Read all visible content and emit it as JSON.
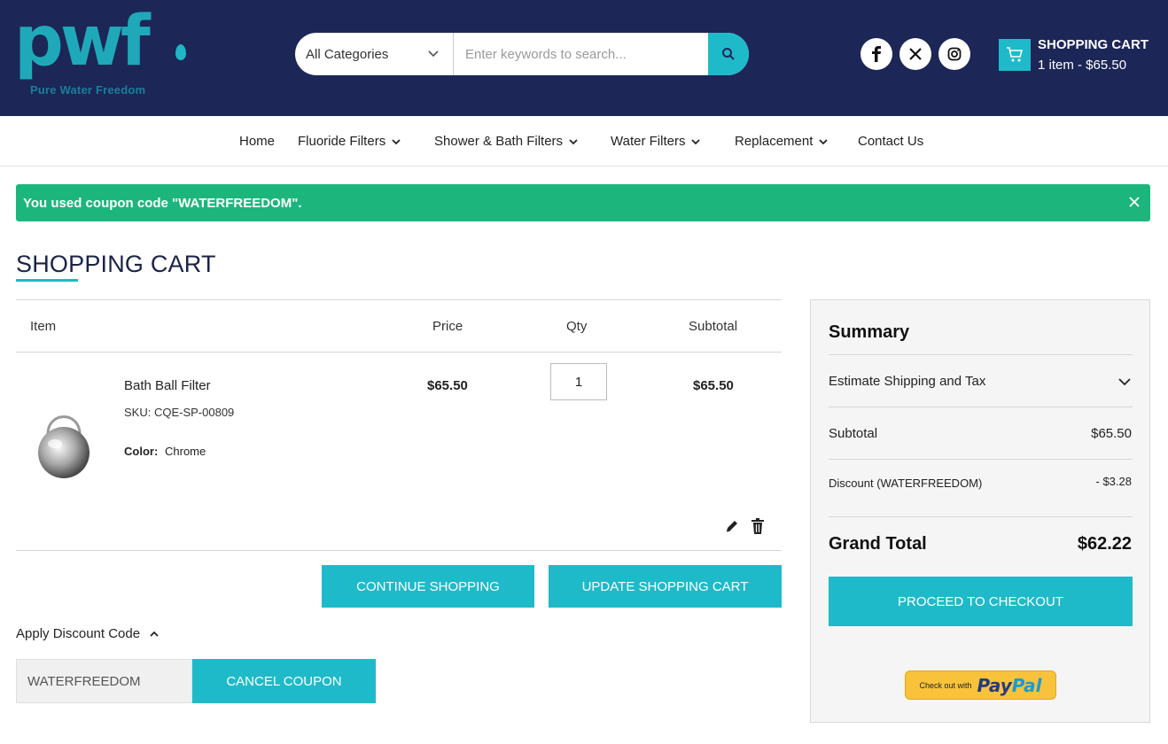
{
  "brand": {
    "logo_text": "pwf",
    "tagline": "Pure Water Freedom",
    "color": "#1fa9b8"
  },
  "header": {
    "bg_color": "#1c2657",
    "search": {
      "category": "All Categories",
      "placeholder": "Enter keywords to search...",
      "button_icon": "search-icon"
    },
    "social": [
      "facebook-icon",
      "x-icon",
      "instagram-icon"
    ],
    "cart": {
      "title": "SHOPPING CART",
      "summary": "1 item - $65.50",
      "icon": "cart-icon"
    }
  },
  "nav": {
    "items": [
      {
        "label": "Home",
        "has_dropdown": false
      },
      {
        "label": "Fluoride Filters",
        "has_dropdown": true
      },
      {
        "label": "Shower & Bath Filters",
        "has_dropdown": true
      },
      {
        "label": "Water Filters",
        "has_dropdown": true
      },
      {
        "label": "Replacement",
        "has_dropdown": true
      },
      {
        "label": "Contact Us",
        "has_dropdown": false
      }
    ]
  },
  "alert": {
    "message": "You used coupon code \"WATERFREEDOM\".",
    "color": "#1cb67c"
  },
  "page": {
    "title": "SHOPPING CART"
  },
  "cart": {
    "columns": [
      "Item",
      "Price",
      "Qty",
      "Subtotal"
    ],
    "items": [
      {
        "name": "Bath Ball Filter",
        "sku": "SKU: CQE-SP-00809",
        "color_label": "Color:",
        "color_value": "Chrome",
        "price": "$65.50",
        "qty": "1",
        "subtotal": "$65.50"
      }
    ],
    "buttons": {
      "continue": "CONTINUE SHOPPING",
      "update": "UPDATE SHOPPING CART"
    },
    "discount": {
      "toggle_label": "Apply Discount Code",
      "code": "WATERFREEDOM",
      "cancel_label": "CANCEL COUPON"
    }
  },
  "summary": {
    "title": "Summary",
    "estimate_label": "Estimate Shipping and Tax",
    "subtotal_label": "Subtotal",
    "subtotal_value": "$65.50",
    "discount_label": "Discount (WATERFREEDOM)",
    "discount_value": "- $3.28",
    "grand_total_label": "Grand Total",
    "grand_total_value": "$62.22",
    "checkout_label": "PROCEED TO CHECKOUT",
    "paypal": {
      "small": "Check out with",
      "pay": "Pay",
      "pal": "Pal"
    }
  },
  "accent_color": "#1fbac9"
}
